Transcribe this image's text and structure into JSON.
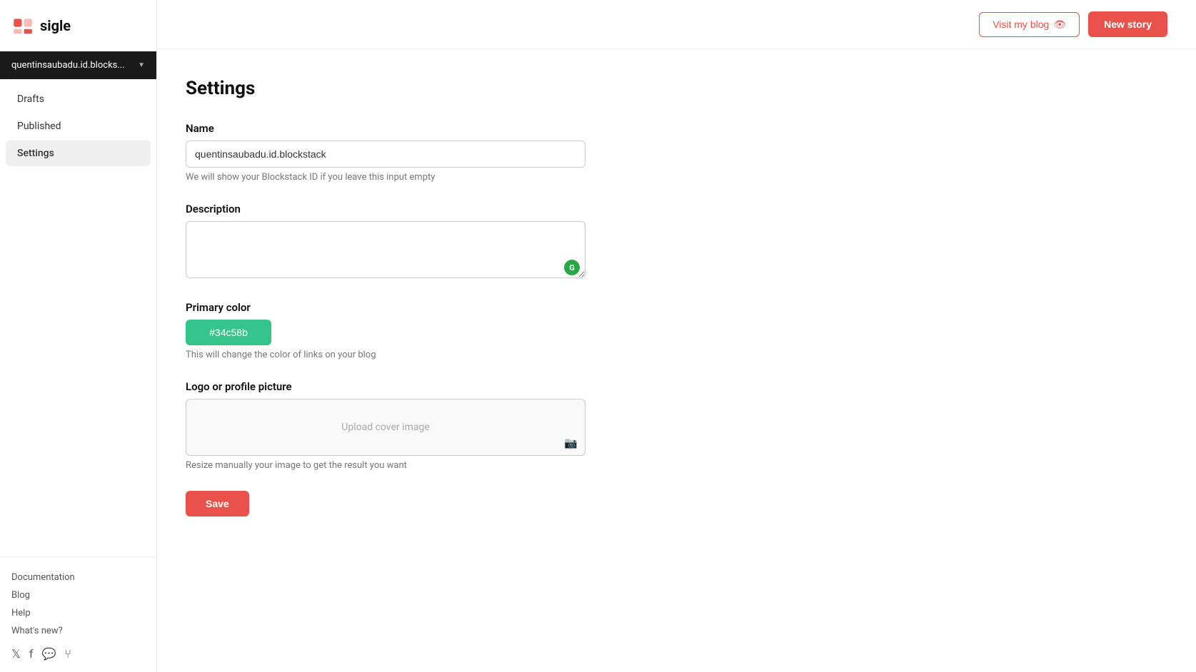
{
  "app": {
    "name": "sigle"
  },
  "sidebar": {
    "account": "quentinsaubadu.id.blocks...",
    "nav": [
      {
        "id": "drafts",
        "label": "Drafts",
        "active": false
      },
      {
        "id": "published",
        "label": "Published",
        "active": false
      },
      {
        "id": "settings",
        "label": "Settings",
        "active": true
      }
    ],
    "footer_links": [
      {
        "id": "documentation",
        "label": "Documentation"
      },
      {
        "id": "blog",
        "label": "Blog"
      },
      {
        "id": "help",
        "label": "Help"
      },
      {
        "id": "whats-new",
        "label": "What's new?"
      }
    ],
    "social": [
      "𝕏",
      "f",
      "□",
      "⑂"
    ]
  },
  "topbar": {
    "visit_blog_label": "Visit my blog",
    "new_story_label": "New story"
  },
  "main": {
    "page_title": "Settings",
    "name_label": "Name",
    "name_value": "quentinsaubadu.id.blockstack",
    "name_hint": "We will show your Blockstack ID if you leave this input empty",
    "description_label": "Description",
    "description_value": "",
    "primary_color_label": "Primary color",
    "primary_color_value": "#34c58b",
    "primary_color_hint": "This will change the color of links on your blog",
    "logo_label": "Logo or profile picture",
    "upload_placeholder": "Upload cover image",
    "upload_hint": "Resize manually your image to get the result you want",
    "save_label": "Save"
  }
}
